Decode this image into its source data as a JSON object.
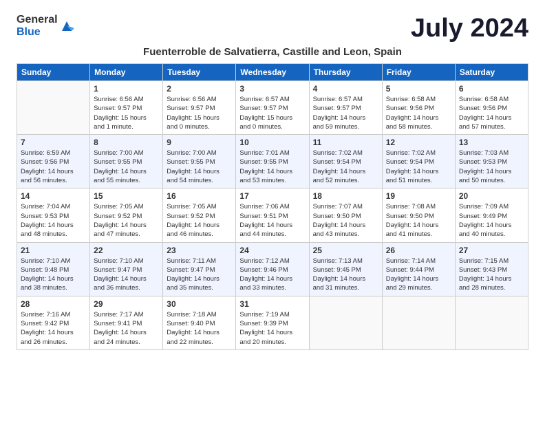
{
  "logo": {
    "line1": "General",
    "line2": "Blue"
  },
  "title": "July 2024",
  "location": "Fuenterroble de Salvatierra, Castille and Leon, Spain",
  "weekdays": [
    "Sunday",
    "Monday",
    "Tuesday",
    "Wednesday",
    "Thursday",
    "Friday",
    "Saturday"
  ],
  "weeks": [
    [
      {
        "day": "",
        "info": ""
      },
      {
        "day": "1",
        "info": "Sunrise: 6:56 AM\nSunset: 9:57 PM\nDaylight: 15 hours\nand 1 minute."
      },
      {
        "day": "2",
        "info": "Sunrise: 6:56 AM\nSunset: 9:57 PM\nDaylight: 15 hours\nand 0 minutes."
      },
      {
        "day": "3",
        "info": "Sunrise: 6:57 AM\nSunset: 9:57 PM\nDaylight: 15 hours\nand 0 minutes."
      },
      {
        "day": "4",
        "info": "Sunrise: 6:57 AM\nSunset: 9:57 PM\nDaylight: 14 hours\nand 59 minutes."
      },
      {
        "day": "5",
        "info": "Sunrise: 6:58 AM\nSunset: 9:56 PM\nDaylight: 14 hours\nand 58 minutes."
      },
      {
        "day": "6",
        "info": "Sunrise: 6:58 AM\nSunset: 9:56 PM\nDaylight: 14 hours\nand 57 minutes."
      }
    ],
    [
      {
        "day": "7",
        "info": "Sunrise: 6:59 AM\nSunset: 9:56 PM\nDaylight: 14 hours\nand 56 minutes."
      },
      {
        "day": "8",
        "info": "Sunrise: 7:00 AM\nSunset: 9:55 PM\nDaylight: 14 hours\nand 55 minutes."
      },
      {
        "day": "9",
        "info": "Sunrise: 7:00 AM\nSunset: 9:55 PM\nDaylight: 14 hours\nand 54 minutes."
      },
      {
        "day": "10",
        "info": "Sunrise: 7:01 AM\nSunset: 9:55 PM\nDaylight: 14 hours\nand 53 minutes."
      },
      {
        "day": "11",
        "info": "Sunrise: 7:02 AM\nSunset: 9:54 PM\nDaylight: 14 hours\nand 52 minutes."
      },
      {
        "day": "12",
        "info": "Sunrise: 7:02 AM\nSunset: 9:54 PM\nDaylight: 14 hours\nand 51 minutes."
      },
      {
        "day": "13",
        "info": "Sunrise: 7:03 AM\nSunset: 9:53 PM\nDaylight: 14 hours\nand 50 minutes."
      }
    ],
    [
      {
        "day": "14",
        "info": "Sunrise: 7:04 AM\nSunset: 9:53 PM\nDaylight: 14 hours\nand 48 minutes."
      },
      {
        "day": "15",
        "info": "Sunrise: 7:05 AM\nSunset: 9:52 PM\nDaylight: 14 hours\nand 47 minutes."
      },
      {
        "day": "16",
        "info": "Sunrise: 7:05 AM\nSunset: 9:52 PM\nDaylight: 14 hours\nand 46 minutes."
      },
      {
        "day": "17",
        "info": "Sunrise: 7:06 AM\nSunset: 9:51 PM\nDaylight: 14 hours\nand 44 minutes."
      },
      {
        "day": "18",
        "info": "Sunrise: 7:07 AM\nSunset: 9:50 PM\nDaylight: 14 hours\nand 43 minutes."
      },
      {
        "day": "19",
        "info": "Sunrise: 7:08 AM\nSunset: 9:50 PM\nDaylight: 14 hours\nand 41 minutes."
      },
      {
        "day": "20",
        "info": "Sunrise: 7:09 AM\nSunset: 9:49 PM\nDaylight: 14 hours\nand 40 minutes."
      }
    ],
    [
      {
        "day": "21",
        "info": "Sunrise: 7:10 AM\nSunset: 9:48 PM\nDaylight: 14 hours\nand 38 minutes."
      },
      {
        "day": "22",
        "info": "Sunrise: 7:10 AM\nSunset: 9:47 PM\nDaylight: 14 hours\nand 36 minutes."
      },
      {
        "day": "23",
        "info": "Sunrise: 7:11 AM\nSunset: 9:47 PM\nDaylight: 14 hours\nand 35 minutes."
      },
      {
        "day": "24",
        "info": "Sunrise: 7:12 AM\nSunset: 9:46 PM\nDaylight: 14 hours\nand 33 minutes."
      },
      {
        "day": "25",
        "info": "Sunrise: 7:13 AM\nSunset: 9:45 PM\nDaylight: 14 hours\nand 31 minutes."
      },
      {
        "day": "26",
        "info": "Sunrise: 7:14 AM\nSunset: 9:44 PM\nDaylight: 14 hours\nand 29 minutes."
      },
      {
        "day": "27",
        "info": "Sunrise: 7:15 AM\nSunset: 9:43 PM\nDaylight: 14 hours\nand 28 minutes."
      }
    ],
    [
      {
        "day": "28",
        "info": "Sunrise: 7:16 AM\nSunset: 9:42 PM\nDaylight: 14 hours\nand 26 minutes."
      },
      {
        "day": "29",
        "info": "Sunrise: 7:17 AM\nSunset: 9:41 PM\nDaylight: 14 hours\nand 24 minutes."
      },
      {
        "day": "30",
        "info": "Sunrise: 7:18 AM\nSunset: 9:40 PM\nDaylight: 14 hours\nand 22 minutes."
      },
      {
        "day": "31",
        "info": "Sunrise: 7:19 AM\nSunset: 9:39 PM\nDaylight: 14 hours\nand 20 minutes."
      },
      {
        "day": "",
        "info": ""
      },
      {
        "day": "",
        "info": ""
      },
      {
        "day": "",
        "info": ""
      }
    ]
  ]
}
